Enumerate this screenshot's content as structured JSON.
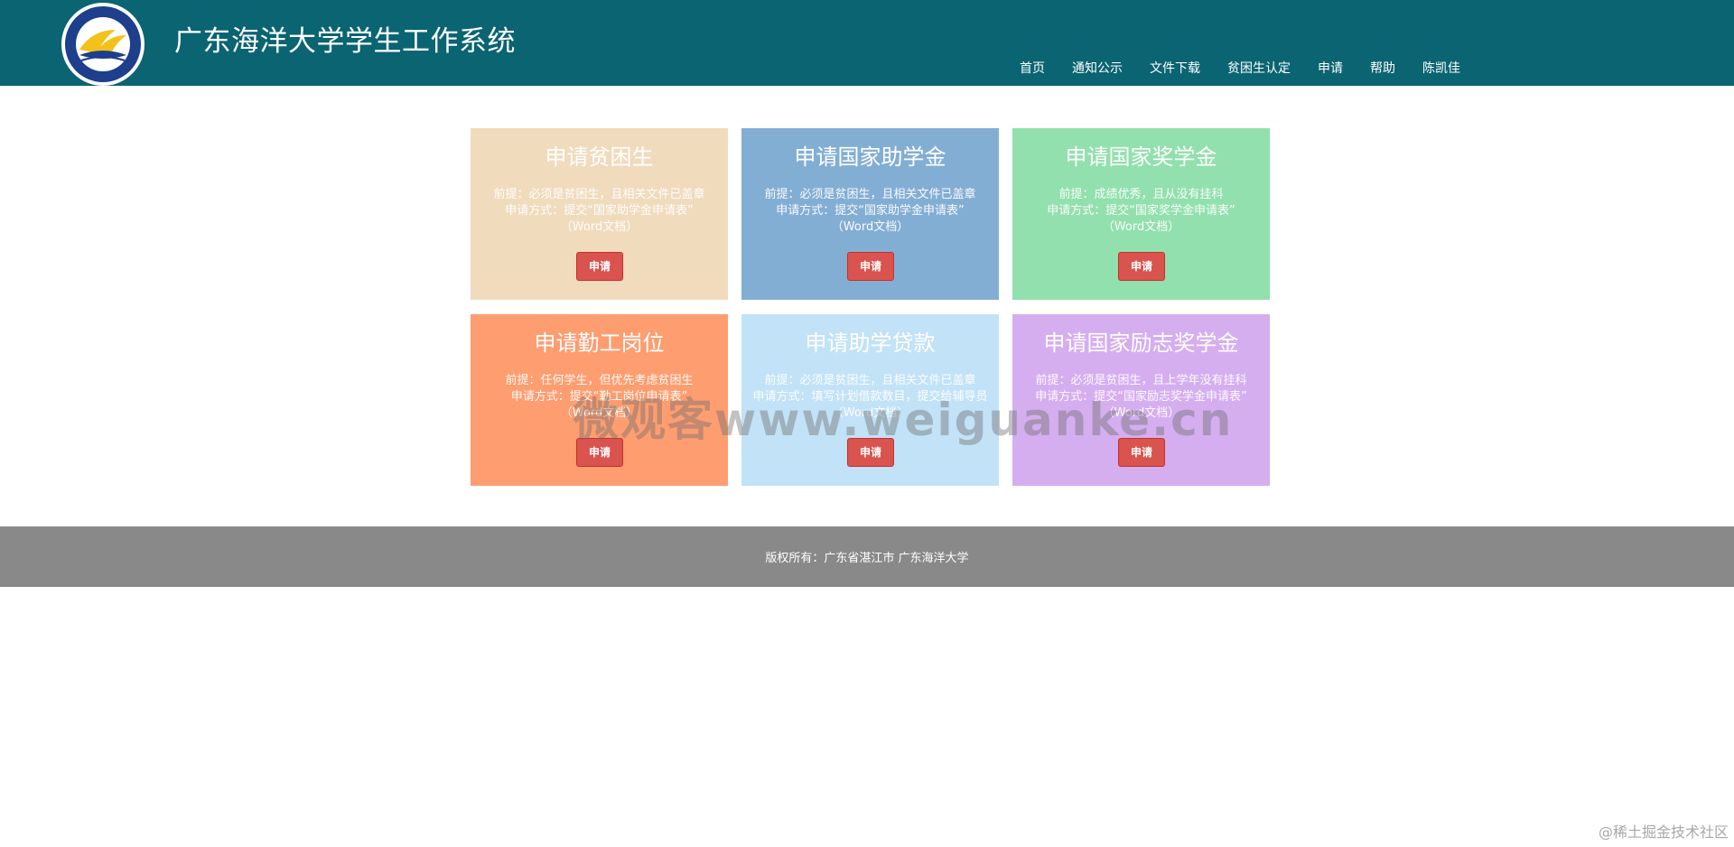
{
  "header": {
    "title": "广东海洋大学学生工作系统",
    "logo_icon": "university-seal-icon",
    "nav": [
      {
        "label": "首页"
      },
      {
        "label": "通知公示"
      },
      {
        "label": "文件下载"
      },
      {
        "label": "贫困生认定"
      },
      {
        "label": "申请"
      },
      {
        "label": "帮助"
      },
      {
        "label": "陈凯佳"
      }
    ]
  },
  "cards": [
    {
      "title": "申请贫困生",
      "lines": [
        "前提：必须是贫困生，且相关文件已盖章",
        "申请方式：提交“国家助学金申请表”",
        "（Word文档）"
      ],
      "button": "申请",
      "color": "#f0dbbd"
    },
    {
      "title": "申请国家助学金",
      "lines": [
        "前提：必须是贫困生，且相关文件已盖章",
        "申请方式：提交“国家助学金申请表”",
        "（Word文档）"
      ],
      "button": "申请",
      "color": "#83aed4"
    },
    {
      "title": "申请国家奖学金",
      "lines": [
        "前提：成绩优秀，且从没有挂科",
        "申请方式：提交“国家奖学金申请表”",
        "（Word文档）"
      ],
      "button": "申请",
      "color": "#92e0ad"
    },
    {
      "title": "申请勤工岗位",
      "lines": [
        "前提：任何学生，但优先考虑贫困生",
        "申请方式：提交“勤工岗位申请表”",
        "（Word文档）"
      ],
      "button": "申请",
      "color": "#fe9d70"
    },
    {
      "title": "申请助学贷款",
      "lines": [
        "前提：必须是贫困生，且相关文件已盖章",
        "申请方式：填写计划借款数目，提交给辅导员",
        "（Word文档）"
      ],
      "button": "申请",
      "color": "#c2e2f7"
    },
    {
      "title": "申请国家励志奖学金",
      "lines": [
        "前提：必须是贫困生，且上学年没有挂科",
        "申请方式：提交“国家励志奖学金申请表”",
        "（Word文档）"
      ],
      "button": "申请",
      "color": "#d5aef0"
    }
  ],
  "watermark": "微观客www.weiguanke.cn",
  "footer": {
    "text": "版权所有：广东省湛江市   广东海洋大学"
  },
  "corner_mark": "@稀土掘金技术社区"
}
